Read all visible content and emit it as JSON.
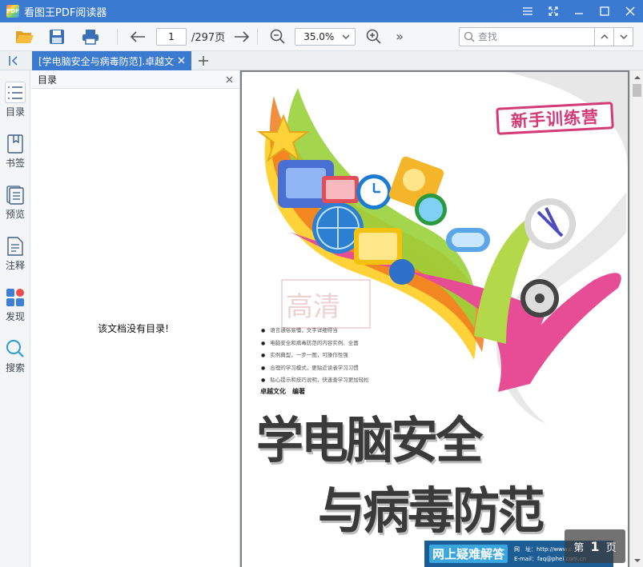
{
  "app": {
    "title": "看图王PDF阅读器",
    "logo_text": "PDF"
  },
  "window_controls": [
    "menu-icon",
    "fullscreen-icon",
    "minimize-icon",
    "maximize-icon",
    "close-icon"
  ],
  "toolbar": {
    "current_page": "1",
    "total_pages": "/297页",
    "zoom": "35.0%",
    "search_placeholder": "查找",
    "more_symbol": "»"
  },
  "tabs": [
    {
      "label": "[学电脑安全与病毒防范].卓越文化"
    }
  ],
  "sidebar": {
    "items": [
      {
        "label": "目录",
        "icon": "toc-list-icon"
      },
      {
        "label": "书签",
        "icon": "bookmark-icon"
      },
      {
        "label": "预览",
        "icon": "preview-pages-icon"
      },
      {
        "label": "注释",
        "icon": "annotation-icon"
      },
      {
        "label": "发现",
        "icon": "discover-apps-icon"
      },
      {
        "label": "搜索",
        "icon": "search-icon"
      }
    ]
  },
  "toc_panel": {
    "title": "目录",
    "empty_message": "该文档没有目录!"
  },
  "document": {
    "badge": "新手训练营",
    "bullets": [
      "语言通俗易懂，文字详细得当",
      "电脑安全和病毒防范的内容实例、全面",
      "实例典型，一步一图，可操作性强",
      "合理的学习模式，更贴近读者学习习惯",
      "贴心提示和技巧说明，快速查学习更加轻松"
    ],
    "publisher": "卓越文化　编著",
    "title_line1": "学电脑安全",
    "title_line2": "与病毒防范",
    "qa_title": "网上疑难解答",
    "qa_line1": "网　址：http://www.c",
    "qa_line2": "E-mail：faq@phei.com.cn"
  },
  "page_indicator": {
    "prefix": "第",
    "number": "1",
    "suffix": "页"
  },
  "colors": {
    "titlebar": "#3a7ad1",
    "tab_active": "#3a7ad1",
    "badge_pink": "#d43a78",
    "viewer_bg": "#7b8188"
  }
}
